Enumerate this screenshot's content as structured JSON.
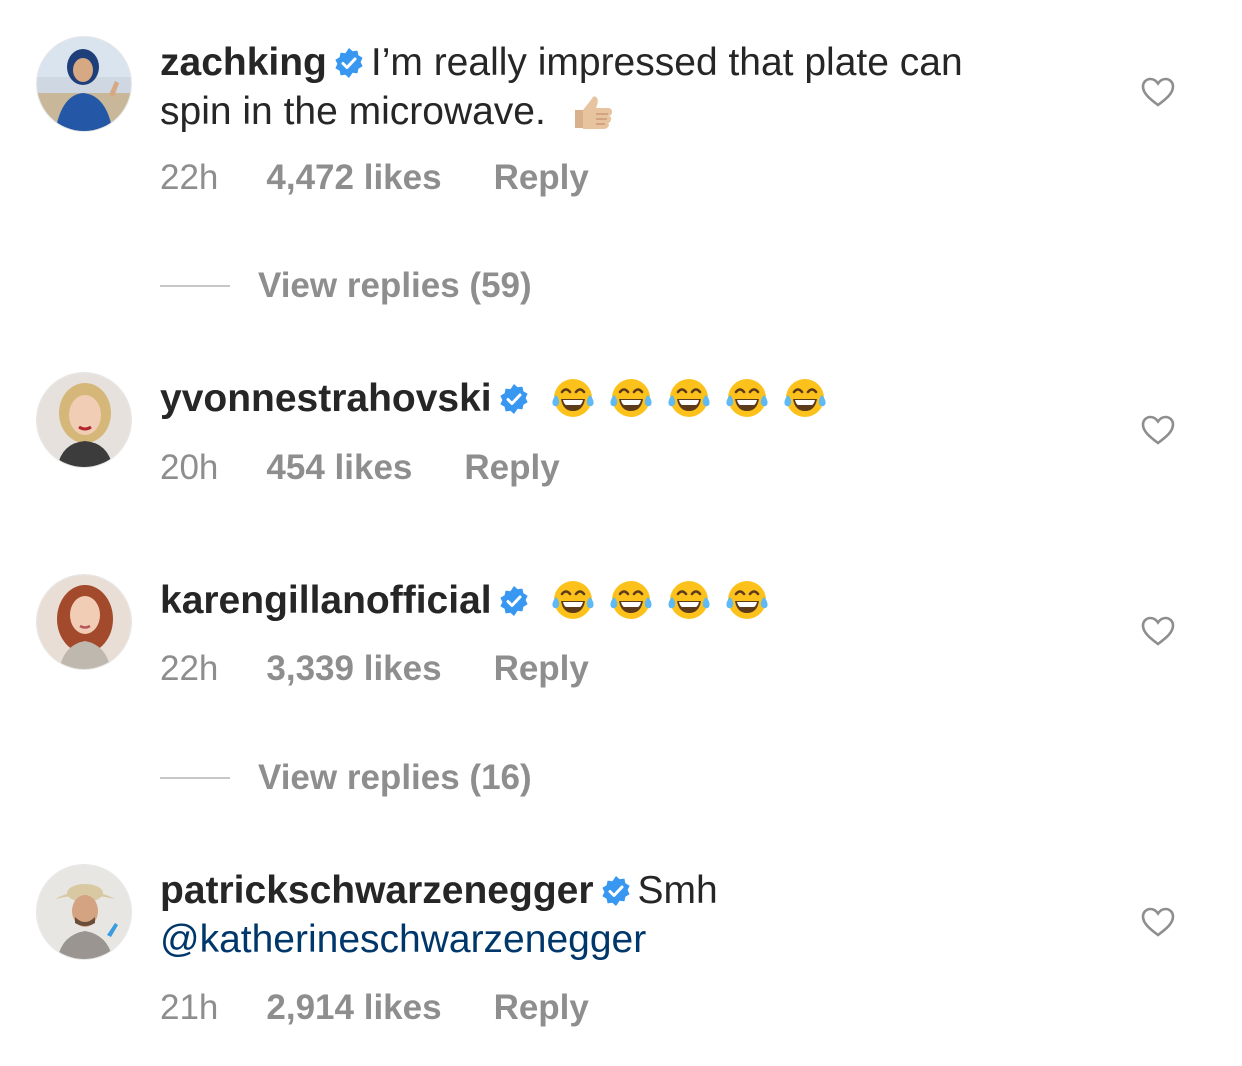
{
  "comments": [
    {
      "username": "zachking",
      "verified": true,
      "text_line1": "I’m really impressed that plate can",
      "text_line2": "spin in the microwave.",
      "trailing_emoji": [
        "thumbs-up"
      ],
      "time": "22h",
      "likes": "4,472 likes",
      "reply_label": "Reply",
      "view_replies": "View replies (59)"
    },
    {
      "username": "yvonnestrahovski",
      "verified": true,
      "emoji": [
        "tears-of-joy",
        "tears-of-joy",
        "tears-of-joy",
        "tears-of-joy",
        "tears-of-joy"
      ],
      "time": "20h",
      "likes": "454 likes",
      "reply_label": "Reply"
    },
    {
      "username": "karengillanofficial",
      "verified": true,
      "emoji": [
        "tears-of-joy",
        "tears-of-joy",
        "tears-of-joy",
        "tears-of-joy"
      ],
      "time": "22h",
      "likes": "3,339 likes",
      "reply_label": "Reply",
      "view_replies": "View replies (16)"
    },
    {
      "username": "patrickschwarzenegger",
      "verified": true,
      "text_line1": "Smh",
      "mention": "@katherineschwarzenegger",
      "time": "21h",
      "likes": "2,914 likes",
      "reply_label": "Reply"
    }
  ],
  "colors": {
    "text": "#262626",
    "meta": "#8e8e8e",
    "verified": "#3897f0",
    "mention": "#00376b",
    "heart_outline": "#8e8e8e"
  },
  "icons": {
    "verified": "verified-badge-icon",
    "like": "heart-outline-icon"
  }
}
